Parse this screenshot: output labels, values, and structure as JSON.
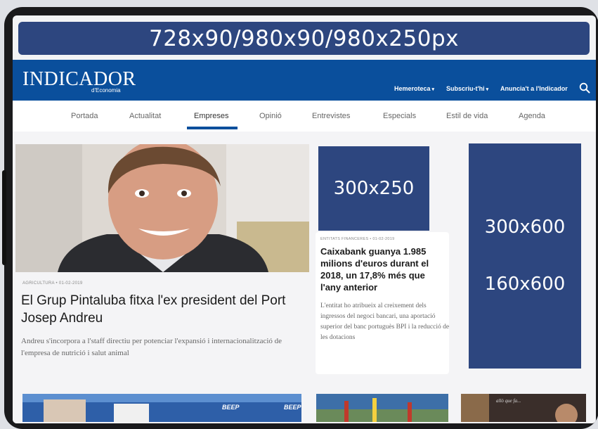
{
  "ad_banner_top": "728x90/980x90/980x250px",
  "header": {
    "logo": "INDICADOR",
    "logo_sub": "d'Economia",
    "links": [
      {
        "label": "Hemeroteca"
      },
      {
        "label": "Subscriu-t'hi"
      },
      {
        "label": "Anuncia't a l'Indicador"
      }
    ]
  },
  "nav": {
    "items": [
      "Portada",
      "Actualitat",
      "Empreses",
      "Opinió",
      "Entrevistes",
      "Especials",
      "Estil de vida",
      "Agenda"
    ],
    "active": "Empreses"
  },
  "articles": {
    "main": {
      "meta": "AGRICULTURA • 01-02-2019",
      "title": "El Grup Pintaluba fitxa l'ex president del Port Josep Andreu",
      "desc": "Andreu s'incorpora a l'staff directiu per potenciar l'expansió i internacionalització de l'empresa de nutrició i salut animal"
    },
    "secondary": {
      "meta": "ENTITATS FINANCERES • 01-02-2019",
      "title": "Caixabank guanya 1.985 milions d'euros durant el 2018, un 17,8% més que l'any anterior",
      "desc": "L'entitat ho atribueix al creixement dels ingressos del negoci bancari, una aportació superior del banc portuguès BPI i la reducció de les dotacions"
    }
  },
  "ads": {
    "box": "300x250",
    "side_line1": "300x600",
    "side_line2": "160x600"
  },
  "thumb_texts": {
    "beep1": "BEEP",
    "beep2": "BEEP",
    "quote": "allò que fa..."
  },
  "colors": {
    "brand_blue": "#0a4f9c",
    "ad_blue": "#2d467f"
  }
}
